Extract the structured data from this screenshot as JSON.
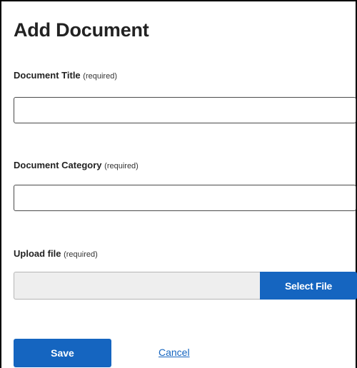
{
  "form": {
    "title": "Add Document",
    "fields": {
      "document_title": {
        "label": "Document Title",
        "required_note": "(required)",
        "value": "",
        "placeholder": ""
      },
      "document_category": {
        "label": "Document Category",
        "required_note": "(required)",
        "value": "",
        "placeholder": ""
      },
      "upload_file": {
        "label": "Upload file",
        "required_note": "(required)",
        "file_name": "",
        "button_label": "Select File"
      }
    },
    "actions": {
      "save_label": "Save",
      "cancel_label": "Cancel"
    }
  },
  "colors": {
    "accent": "#1565c0",
    "file_field_bg": "#eeeeee",
    "border": "#4a4a4a"
  }
}
